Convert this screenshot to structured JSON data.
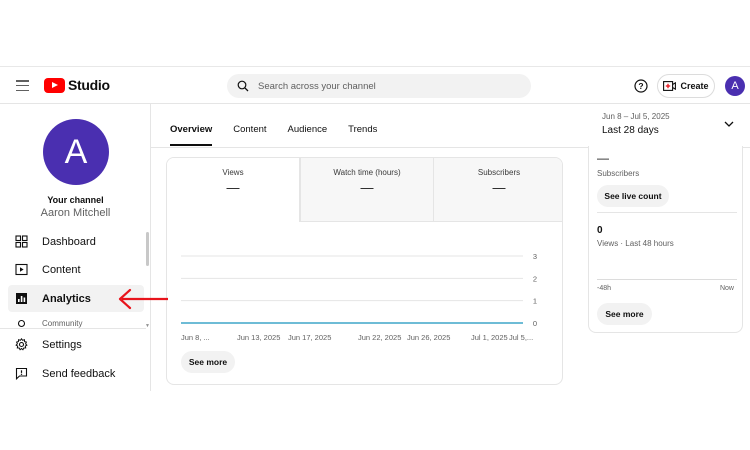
{
  "header": {
    "logo_text": "Studio",
    "search_placeholder": "Search across your channel",
    "create_label": "Create",
    "avatar_letter": "A"
  },
  "sidebar": {
    "avatar_letter": "A",
    "channel_title": "Your channel",
    "channel_name": "Aaron Mitchell",
    "items": [
      {
        "label": "Dashboard",
        "icon": "dashboard-icon"
      },
      {
        "label": "Content",
        "icon": "content-icon"
      },
      {
        "label": "Analytics",
        "icon": "analytics-icon",
        "active": true
      },
      {
        "label": "Community",
        "icon": "community-icon"
      },
      {
        "label": "Settings",
        "icon": "gear-icon"
      },
      {
        "label": "Send feedback",
        "icon": "feedback-icon"
      }
    ]
  },
  "tabs": [
    "Overview",
    "Content",
    "Audience",
    "Trends"
  ],
  "date_range": {
    "range": "Jun 8 – Jul 5, 2025",
    "label": "Last 28 days"
  },
  "metrics": [
    {
      "label": "Views",
      "value": "—"
    },
    {
      "label": "Watch time (hours)",
      "value": "—"
    },
    {
      "label": "Subscribers",
      "value": "—"
    }
  ],
  "chart_data": {
    "type": "line",
    "x": [
      "Jun 8, ...",
      "Jun 13, 2025",
      "Jun 17, 2025",
      "Jun 22, 2025",
      "Jun 26, 2025",
      "Jul 1, 2025",
      "Jul 5,..."
    ],
    "series": [
      {
        "values": [
          0,
          0,
          0,
          0,
          0,
          0,
          0
        ]
      }
    ],
    "y_ticks": [
      "3",
      "2",
      "1",
      "0"
    ],
    "ylim": [
      0,
      3
    ],
    "grid": true,
    "line_color": "#3ea6c9"
  },
  "main_see_more": "See more",
  "realtime": {
    "subscribers_value": "—",
    "subscribers_label": "Subscribers",
    "see_live_count": "See live count",
    "views_value": "0",
    "views_label": "Views · Last 48 hours",
    "axis_start": "-48h",
    "axis_end": "Now",
    "see_more": "See more"
  },
  "colors": {
    "brand": "#ff0000",
    "avatar": "#4a2fb0",
    "arrow": "#e8141c"
  }
}
